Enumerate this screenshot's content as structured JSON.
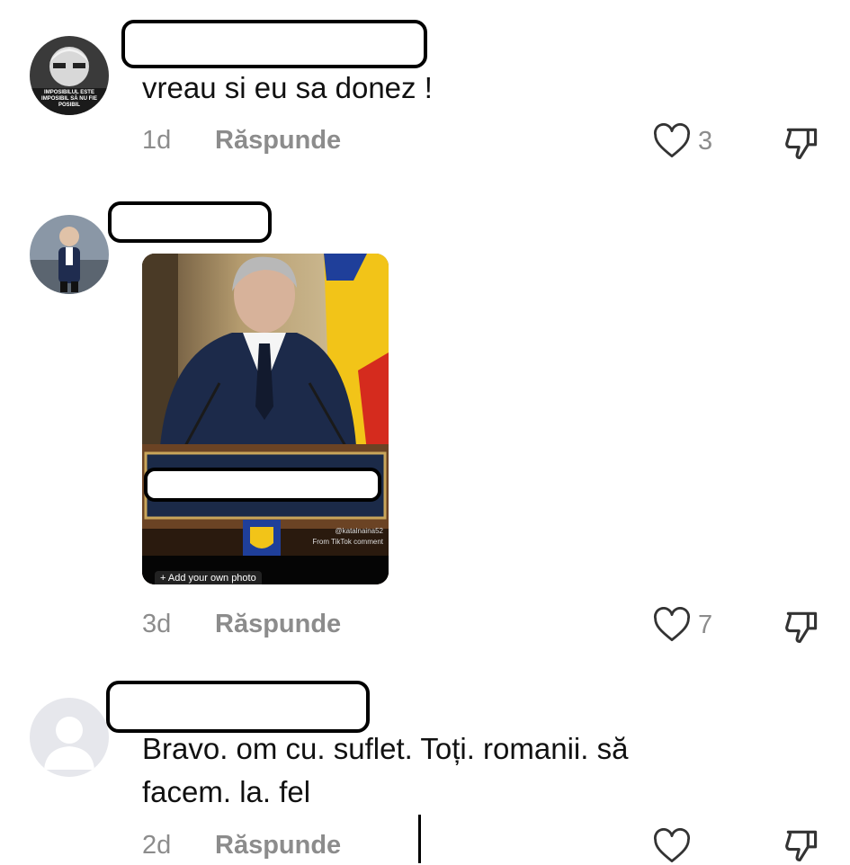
{
  "comments": [
    {
      "text": "vreau si eu sa donez !",
      "time": "1d",
      "reply_label": "Răspunde",
      "likes": "3",
      "avatar_caption": "IMPOSIBILUL ESTE IMPOSIBIL SĂ NU FIE POSIBIL"
    },
    {
      "text": "",
      "time": "3d",
      "reply_label": "Răspunde",
      "likes": "7",
      "photo": {
        "credit_handle": "@katalnaina52",
        "credit_source": "From TikTok comment",
        "add_photo_label": "+ Add your own photo"
      }
    },
    {
      "text": "Bravo. om cu. suflet. Toți. romanii. să\nfacem. la. fel",
      "time": "2d",
      "reply_label": "Răspunde",
      "likes": ""
    }
  ],
  "icons": {
    "like": "heart-outline-icon",
    "dislike": "thumbs-down-icon"
  },
  "colors": {
    "meta_text": "#8c8c8c",
    "flag_blue": "#1f3f9a",
    "flag_yellow": "#f2c418",
    "flag_red": "#d52b1e"
  }
}
